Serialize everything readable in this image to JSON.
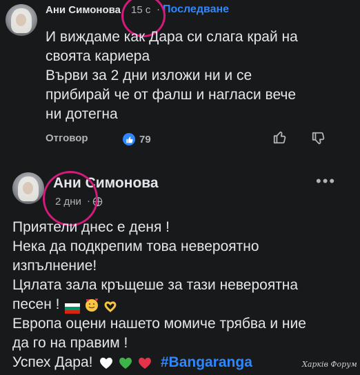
{
  "comment1": {
    "author": "Ани Симонова",
    "time": "15 с",
    "follow": "Последване",
    "lines": [
      "И виждаме как Дара си слага край на",
      "своята кариера",
      "Върви за 2 дни изложи ни и се",
      "прибирай че от фалш и нагласи вече",
      "ни дотегна"
    ],
    "reply_label": "Отговор",
    "like_count": "79"
  },
  "comment2": {
    "author": "Ани Симонова",
    "time": "2 дни",
    "lines": [
      "Приятели днес е деня !",
      "Нека да подкрепим това невероятно",
      "изпълнение!",
      "Цялата зала кръщеше за тази невероятна",
      "песен !",
      "Европа оцени нашето момиче трябва и ние",
      "да го на правим !",
      "Успех Дара!"
    ],
    "hashtag": "#Bangaranga"
  },
  "watermark": "Харків Форум",
  "colors": {
    "background": "#18191a",
    "text": "#e4e6eb",
    "secondary": "#b0b3b8",
    "link": "#2d88ff",
    "annotation_ring": "#d21b7a"
  }
}
